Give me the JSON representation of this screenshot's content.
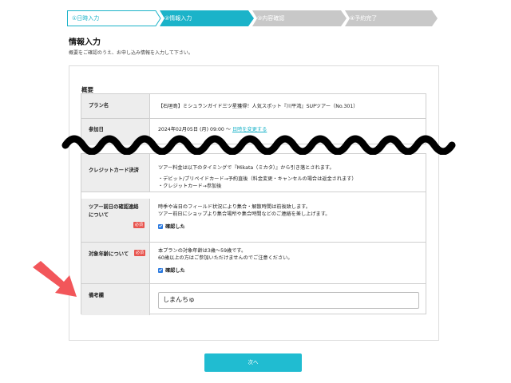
{
  "steps": [
    {
      "label": "①日時入力",
      "state": "done"
    },
    {
      "label": "②情報入力",
      "state": "current"
    },
    {
      "label": "③内容確認",
      "state": "upcoming"
    },
    {
      "label": "④予約完了",
      "state": "upcoming"
    }
  ],
  "page": {
    "title": "情報入力",
    "subtitle": "概要をご確認のうえ、お申し込み情報を入力して下さい。"
  },
  "summary": {
    "section_title": "概要",
    "plan_label": "プラン名",
    "plan_value": "【石垣島】ミシュランガイド三ツ星獲得！人気スポット『川平湾』SUPツアー（No.301）",
    "date_label": "参加日",
    "date_value": "2024年02月05日 (月) 09:00 〜",
    "date_change_link": "日時を変更する",
    "payment_label": "クレジットカード決済",
    "payment_lines": [
      "ツアー料金は以下のタイミングで『Mikata（ミカタ）』から引き落とされます。",
      "・デビット/プリペイドカード→予約直後（料金変更・キャンセルの場合は返金されます）",
      "・クレジットカード→参加後"
    ],
    "contact_label_line1": "ツアー前日の確認連絡",
    "contact_label_line2": "について",
    "contact_lines": [
      "時季や当日のフィールド状況により集合・解散時間は前後致します。",
      "ツアー前日にショップより集合場所や集合時間などのご連絡を差し上げます。"
    ],
    "contact_confirm": "確認した",
    "age_label": "対象年齢について",
    "age_lines": [
      "本プランの対象年齢は3歳〜59歳です。",
      "60歳以上の方はご参加いただけませんのでご注意ください。"
    ],
    "age_confirm": "確認した",
    "required_badge": "必須",
    "notes_label": "備考欄",
    "notes_value": "しまんちゅ"
  },
  "next_button": "次へ",
  "colors": {
    "accent": "#1bb3c9",
    "required": "#e8554f",
    "arrow": "#f2565a",
    "step_inactive": "#c8c8c8"
  }
}
